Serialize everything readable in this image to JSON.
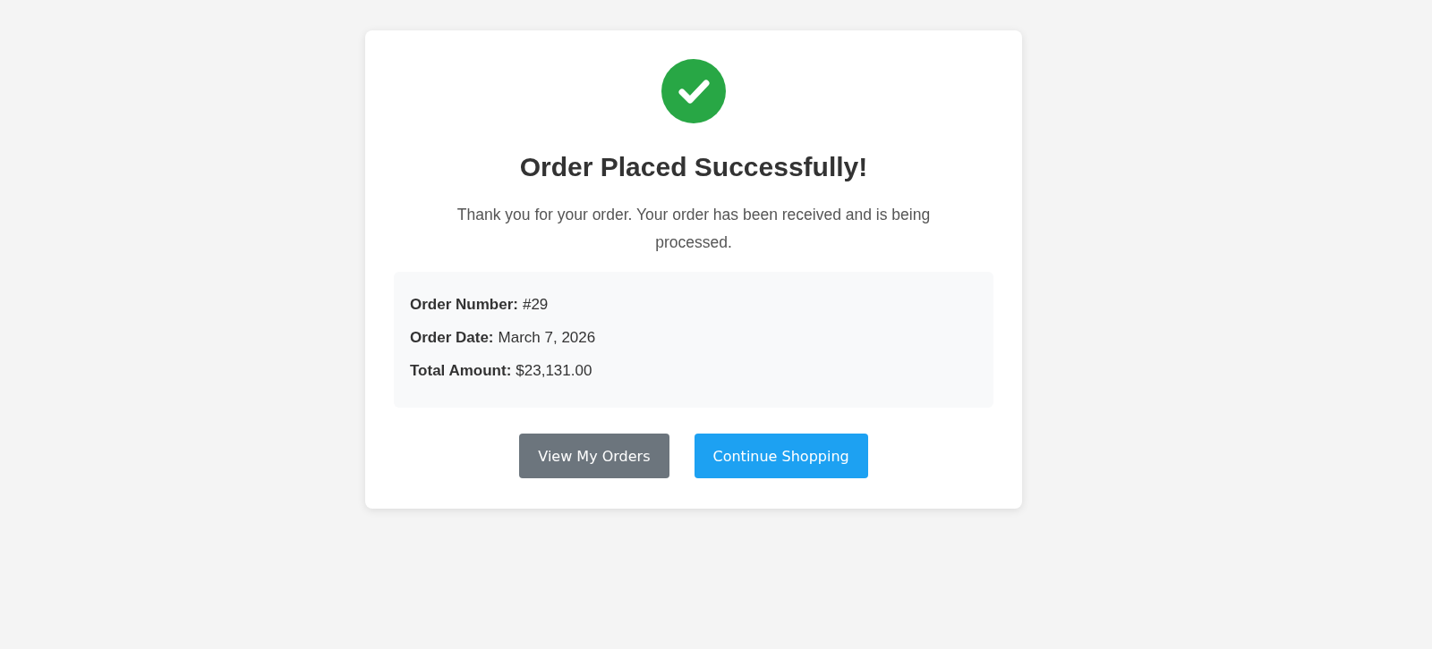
{
  "confirmation": {
    "title": "Order Placed Successfully!",
    "message": "Thank you for your order. Your order has been received and is being processed.",
    "details": [
      {
        "label": "Order Number:",
        "value": "#29"
      },
      {
        "label": "Order Date:",
        "value": "March 7, 2026"
      },
      {
        "label": "Total Amount:",
        "value": "$23,131.00"
      }
    ],
    "buttons": [
      {
        "label": "View My Orders",
        "kind": "secondary"
      },
      {
        "label": "Continue Shopping",
        "kind": "primary"
      }
    ]
  }
}
